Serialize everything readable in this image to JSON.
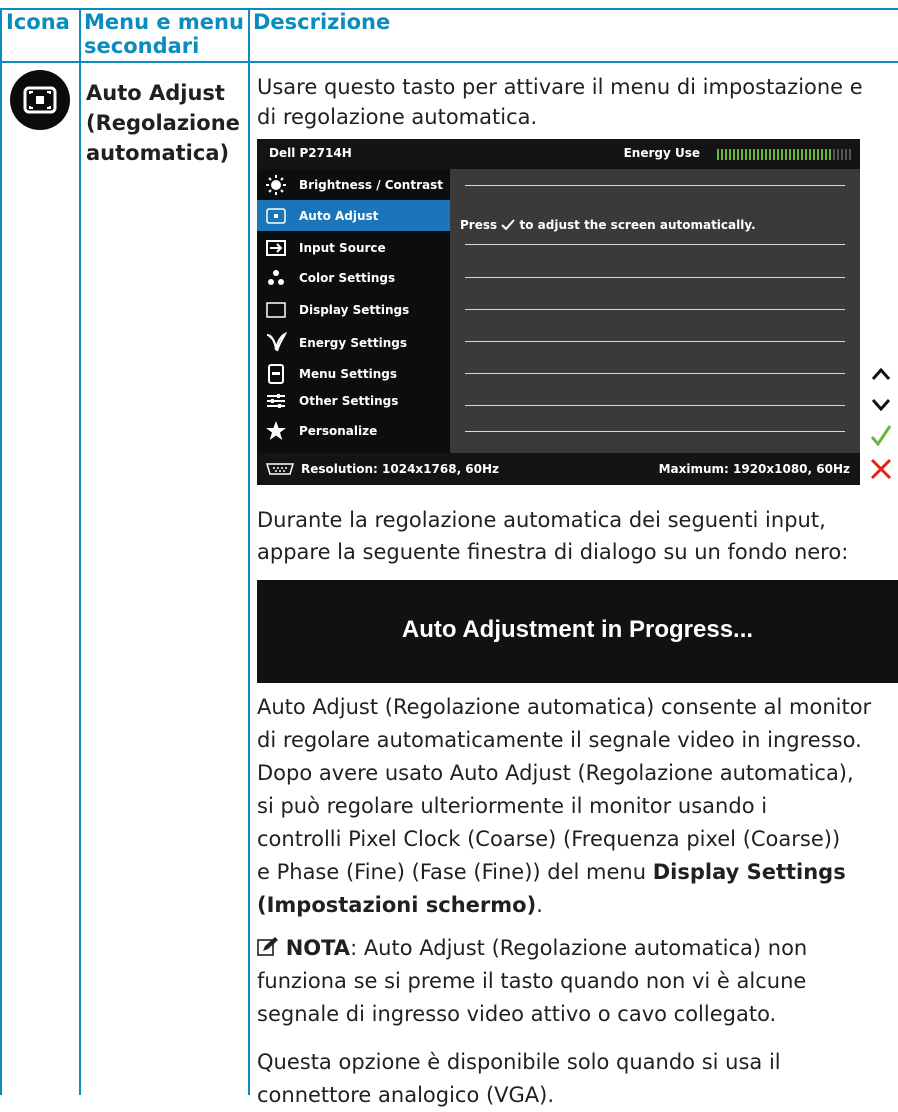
{
  "table": {
    "headers": [
      "Icona",
      "Menu e menu secondari",
      "Descrizione"
    ],
    "header_menu_line1": "Menu e menu",
    "header_menu_line2": "secondari"
  },
  "row": {
    "icon": "auto-adjust-icon",
    "menu_lines": [
      "Auto Adjust",
      "(Regolazione",
      "automatica)"
    ],
    "intro_lines": [
      "Usare questo tasto per attivare il menu di impostazione e",
      "di regolazione automatica."
    ]
  },
  "osd": {
    "model": "Dell P2714H",
    "energy_label": "Energy Use",
    "energy_level": 0.85,
    "selected_index": 1,
    "items": [
      {
        "label": "Brightness / Contrast",
        "icon": "brightness-icon"
      },
      {
        "label": "Auto Adjust",
        "icon": "auto-adjust-icon"
      },
      {
        "label": "Input Source",
        "icon": "input-source-icon"
      },
      {
        "label": "Color Settings",
        "icon": "color-settings-icon"
      },
      {
        "label": "Display Settings",
        "icon": "display-settings-icon"
      },
      {
        "label": "Energy Settings",
        "icon": "energy-settings-icon"
      },
      {
        "label": "Menu Settings",
        "icon": "menu-settings-icon"
      },
      {
        "label": "Other Settings",
        "icon": "other-settings-icon"
      },
      {
        "label": "Personalize",
        "icon": "star-icon"
      }
    ],
    "message_prefix": "Press",
    "message_suffix": "to adjust the screen automatically.",
    "resolution": "Resolution: 1024x1768, 60Hz",
    "maximum": "Maximum: 1920x1080, 60Hz",
    "buttons": [
      "up-arrow-icon",
      "down-arrow-icon",
      "check-icon",
      "close-icon"
    ],
    "colors": {
      "selected": "#1b75bb",
      "energy_on": "#6ab43e",
      "check": "#6ab43e",
      "close": "#e2231a"
    }
  },
  "dialog_intro_lines": [
    "Durante la regolazione automatica dei seguenti input,",
    "appare la seguente finestra di dialogo su un fondo nero:"
  ],
  "progress_text": "Auto Adjustment in Progress...",
  "description": {
    "lines": [
      "Auto Adjust (Regolazione automatica) consente al monitor",
      "di regolare automaticamente il segnale video in ingresso.",
      "Dopo avere usato Auto Adjust (Regolazione automatica),",
      "si può regolare ulteriormente il monitor usando i",
      "controlli Pixel Clock (Coarse) (Frequenza pixel (Coarse))"
    ],
    "line6_prefix": "e Phase (Fine) (Fase (Fine)) del menu ",
    "line6_bold": "Display Settings",
    "line7_bold": "(Impostazioni schermo)",
    "line7_suffix": "."
  },
  "note": {
    "label": "NOTA",
    "icon": "pencil-note-icon",
    "line1_suffix": ": Auto Adjust (Regolazione automatica) non",
    "lines": [
      "funziona se si preme il tasto quando non vi è alcune",
      "segnale di ingresso video attivo o cavo collegato."
    ]
  },
  "footer_lines": [
    "Questa opzione è disponibile solo quando si usa il",
    "connettore analogico (VGA)."
  ]
}
